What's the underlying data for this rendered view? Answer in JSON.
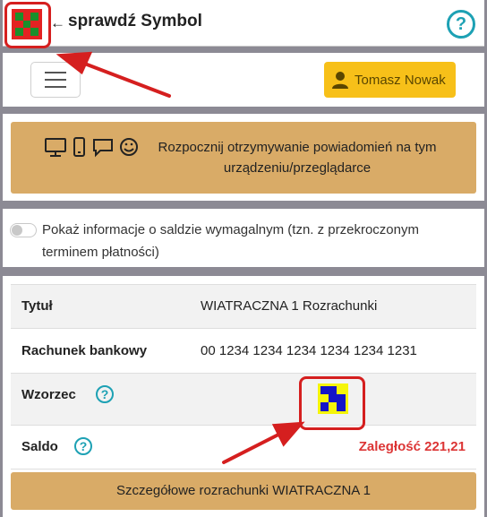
{
  "header": {
    "arrow_glyph": "←",
    "title": "sprawdź Symbol",
    "help_glyph": "?",
    "logo_colors": {
      "bg": "#e32222",
      "cells": "#1a8f2b"
    }
  },
  "nav": {
    "user_name": "Tomasz Nowak",
    "user_icon": "user-icon",
    "accent": "#f7c019"
  },
  "notify": {
    "icons": [
      "desktop-icon",
      "phone-icon",
      "chat-icon",
      "smile-icon"
    ],
    "text": "Rozpocznij otrzymywanie powiadomień na tym urządzeniu/przeglądarce"
  },
  "balance": {
    "toggle_on": false,
    "text": "Pokaż informacje o saldzie wymagalnym (tzn. z przekroczonym terminem płatności)"
  },
  "details": {
    "rows": [
      {
        "label": "Tytuł",
        "value": "WIATRACZNA 1 Rozrachunki"
      },
      {
        "label": "Rachunek bankowy",
        "value": "00 1234 1234 1234 1234 1234 1231"
      },
      {
        "label": "Wzorzec",
        "value": ""
      },
      {
        "label": "Saldo",
        "value": "Zaległość 221,21"
      }
    ],
    "help_glyph": "?",
    "pattern_colors": {
      "bg": "#f5f50a",
      "cells": "#1414c8"
    },
    "overdue_color": "#dc3535",
    "button_label": "Szczegółowe rozrachunki WIATRACZNA 1"
  }
}
